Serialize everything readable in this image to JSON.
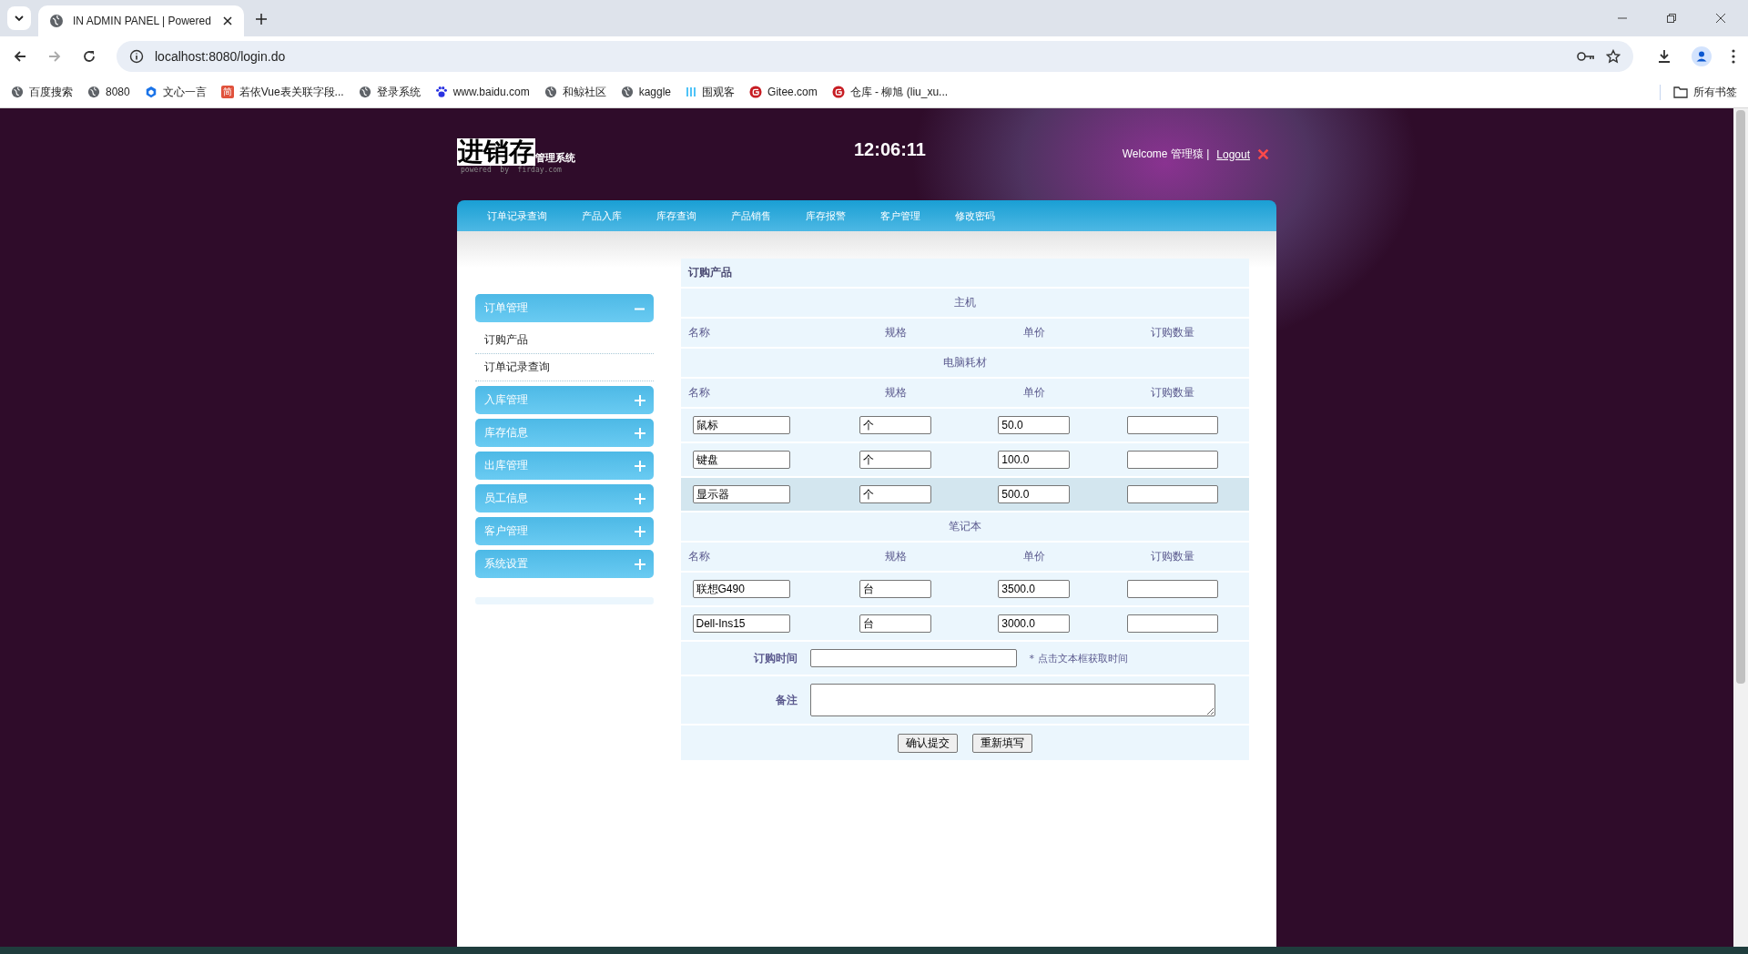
{
  "browser": {
    "tab_title": "IN ADMIN PANEL | Powered",
    "address": "localhost:8080/login.do",
    "bookmarks": [
      {
        "label": "百度搜索",
        "kind": "globe"
      },
      {
        "label": "8080",
        "kind": "globe"
      },
      {
        "label": "文心一言",
        "kind": "cube"
      },
      {
        "label": "若依Vue表关联字段...",
        "kind": "badge",
        "badge_text": "简"
      },
      {
        "label": "登录系统",
        "kind": "globe"
      },
      {
        "label": "www.baidu.com",
        "kind": "paw"
      },
      {
        "label": "和鲸社区",
        "kind": "globe"
      },
      {
        "label": "kaggle",
        "kind": "globe"
      },
      {
        "label": "围观客",
        "kind": "bars"
      },
      {
        "label": "Gitee.com",
        "kind": "gitee"
      },
      {
        "label": "仓库 - 柳旭 (liu_xu...",
        "kind": "gitee"
      }
    ],
    "all_bookmarks": "所有书签"
  },
  "header": {
    "logo": "进销存",
    "logo_sub": "管理系统",
    "powered": "powered  by  firday.com",
    "clock": "12:06:11",
    "welcome": "Welcome 管理猿 |",
    "logout": "Logout"
  },
  "nav": [
    {
      "label": "订单记录查询",
      "selected": false
    },
    {
      "label": "产品入库",
      "selected": false
    },
    {
      "label": "库存查询",
      "selected": false
    },
    {
      "label": "产品销售",
      "selected": false
    },
    {
      "label": "库存报警",
      "selected": false
    },
    {
      "label": "客户管理",
      "selected": false
    },
    {
      "label": "修改密码",
      "selected": false
    }
  ],
  "sidebar": [
    {
      "label": "订单管理",
      "expanded": true,
      "items": [
        "订购产品",
        "订单记录查询"
      ]
    },
    {
      "label": "入库管理",
      "expanded": false
    },
    {
      "label": "库存信息",
      "expanded": false
    },
    {
      "label": "出库管理",
      "expanded": false
    },
    {
      "label": "员工信息",
      "expanded": false
    },
    {
      "label": "客户管理",
      "expanded": false
    },
    {
      "label": "系统设置",
      "expanded": false
    }
  ],
  "form": {
    "title": "订购产品",
    "sections": [
      {
        "title": "主机",
        "columns": [
          "名称",
          "规格",
          "单价",
          "订购数量"
        ]
      },
      {
        "title": "电脑耗材",
        "columns": [
          "名称",
          "规格",
          "单价",
          "订购数量"
        ],
        "rows": [
          {
            "name": "鼠标",
            "unit": "个",
            "price": "50.0",
            "highlighted": false
          },
          {
            "name": "键盘",
            "unit": "个",
            "price": "100.0",
            "highlighted": false
          },
          {
            "name": "显示器",
            "unit": "个",
            "price": "500.0",
            "highlighted": true
          }
        ]
      },
      {
        "title": "笔记本",
        "columns": [
          "名称",
          "规格",
          "单价",
          "订购数量"
        ],
        "rows": [
          {
            "name": "联想G490",
            "unit": "台",
            "price": "3500.0",
            "highlighted": false
          },
          {
            "name": "Dell-Ins15",
            "unit": "台",
            "price": "3000.0",
            "highlighted": false
          }
        ]
      }
    ],
    "time_label": "订购时间",
    "time_hint": "* 点击文本框获取时间",
    "note_label": "备注",
    "buttons": [
      "确认提交",
      "重新填写"
    ]
  }
}
